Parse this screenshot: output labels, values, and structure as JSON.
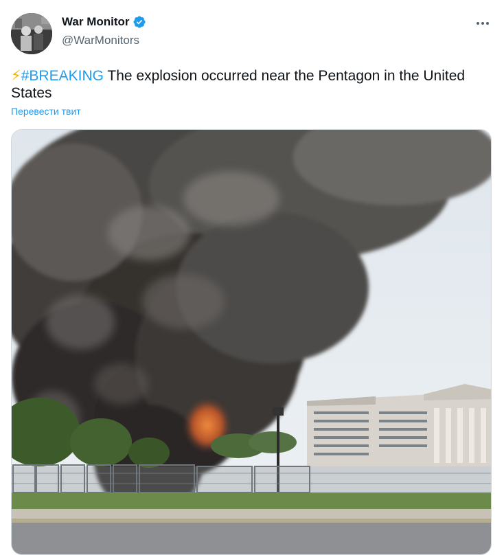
{
  "author": {
    "display_name": "War Monitor",
    "handle": "@WarMonitors",
    "verified": true
  },
  "tweet": {
    "emoji": "⚡",
    "hashtag": "#BREAKING",
    "text": " The explosion occurred near the Pentagon in the United States",
    "translate_label": "Перевести твит"
  },
  "icons": {
    "verified": "verified-badge-icon",
    "more": "more-options-icon"
  },
  "colors": {
    "link_blue": "#1d9bf0",
    "text": "#0f1419",
    "muted": "#536471",
    "bolt": "#f4b400"
  }
}
